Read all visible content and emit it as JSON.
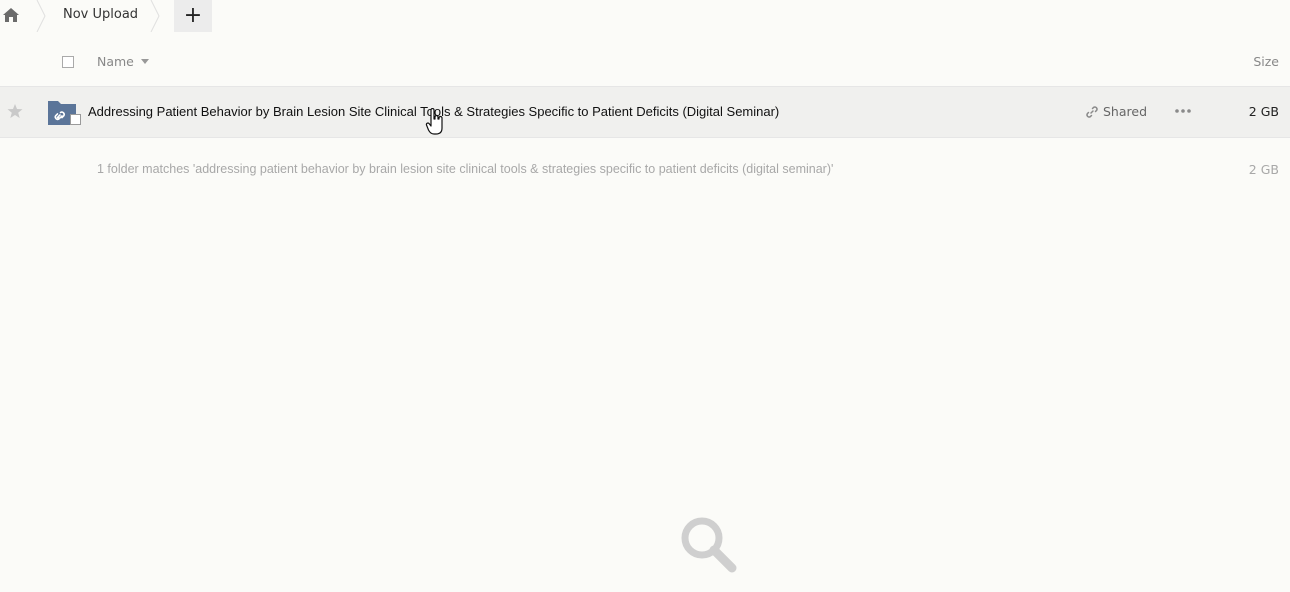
{
  "breadcrumb": {
    "home_icon": "home-icon",
    "current_folder": "Nov Upload",
    "add_icon": "+"
  },
  "table_header": {
    "name_label": "Name",
    "size_label": "Size",
    "sort_icon": "caret-down-icon"
  },
  "files": [
    {
      "name": "Addressing Patient Behavior by Brain Lesion Site Clinical Tools & Strategies Specific to Patient Deficits (Digital Seminar)",
      "type_icon": "shared-folder-icon",
      "share_label": "Shared",
      "size": "2 GB",
      "favorite": false
    }
  ],
  "summary": {
    "text": "1 folder matches 'addressing patient behavior by brain lesion site clinical tools & strategies specific to patient deficits (digital seminar)'",
    "size": "2 GB"
  },
  "colors": {
    "background": "#fbfbf8",
    "row_highlight": "#f0f0ee",
    "folder_blue": "#5b7599",
    "muted_text": "#a8a8a8"
  }
}
